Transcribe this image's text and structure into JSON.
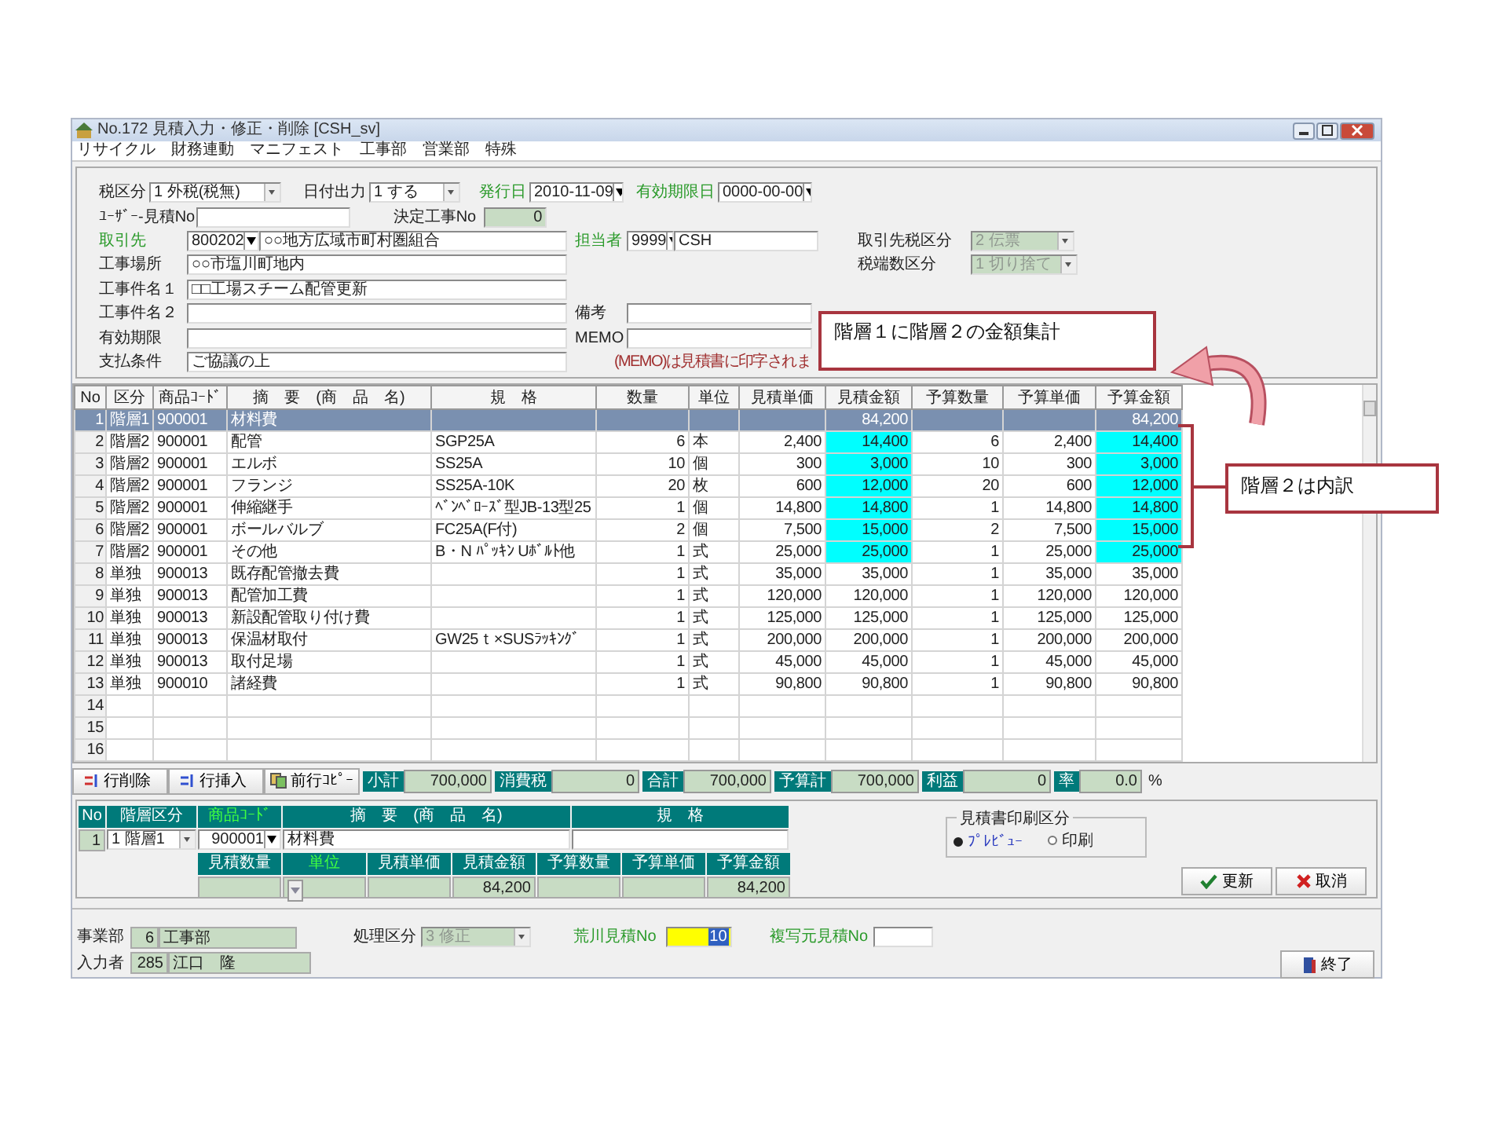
{
  "window": {
    "title": "No.172 見積入力・修正・削除 [CSH_sv]"
  },
  "menu": [
    "リサイクル",
    "財務連動",
    "マニフェスト",
    "工事部",
    "営業部",
    "特殊"
  ],
  "form": {
    "tax_category": {
      "label": "税区分",
      "value": "1 外税(税無)",
      "link": false
    },
    "date_output": {
      "label": "日付出力",
      "value": "1 する",
      "link": false
    },
    "issue_date": {
      "label": "発行日",
      "value": "2010-11-09",
      "link": true
    },
    "expiry_date": {
      "label": "有効期限日",
      "value": "0000-00-00",
      "link": true
    },
    "user_estimate_no": {
      "label": "ﾕｰｻﾞｰ-見積No",
      "link": false
    },
    "decided_job_no": {
      "label": "決定工事No",
      "value": "0",
      "link": false
    },
    "client": {
      "label": "取引先",
      "code": "800202",
      "name": "○○地方広域市町村圏組合",
      "link": true
    },
    "staff": {
      "label": "担当者",
      "code": "9999",
      "name": "CSH",
      "link": true
    },
    "client_tax": {
      "label": "取引先税区分",
      "value": "2 伝票",
      "disabled": true
    },
    "rounding": {
      "label": "税端数区分",
      "value": "1 切り捨て",
      "disabled": true
    },
    "site": {
      "label": "工事場所",
      "value": "○○市塩川町地内"
    },
    "job_name_1": {
      "label": "工事件名１",
      "value": "□□工場スチーム配管更新"
    },
    "job_name_2": {
      "label": "工事件名２"
    },
    "remarks": {
      "label": "備考"
    },
    "validity": {
      "label": "有効期限"
    },
    "memo": {
      "label": "MEMO"
    },
    "payment": {
      "label": "支払条件",
      "value": "ご協議の上"
    },
    "memo_note": "(MEMO)は見積書に印字されま"
  },
  "table": {
    "columns": [
      "No",
      "区分",
      "商品ｺｰﾄﾞ",
      "摘　要　(商　品　名)",
      "規　格",
      "数量",
      "単位",
      "見積単価",
      "見積金額",
      "予算数量",
      "予算単価",
      "予算金額"
    ],
    "rows": [
      {
        "no": "1",
        "category": "階層1",
        "code": "900001",
        "name": "材料費",
        "amount": "84,200",
        "budget_amount": "84,200",
        "selected": true,
        "highlight": false
      },
      {
        "no": "2",
        "category": "階層2",
        "code": "900001",
        "name": "配管",
        "spec": "SGP25A",
        "qty": "6",
        "unit": "本",
        "unit_price": "2,400",
        "amount": "14,400",
        "budget_qty": "6",
        "budget_price": "2,400",
        "budget_amount": "14,400",
        "selected": false,
        "highlight": true
      },
      {
        "no": "3",
        "category": "階層2",
        "code": "900001",
        "name": "エルボ",
        "spec": "SS25A",
        "qty": "10",
        "unit": "個",
        "unit_price": "300",
        "amount": "3,000",
        "budget_qty": "10",
        "budget_price": "300",
        "budget_amount": "3,000",
        "selected": false,
        "highlight": true
      },
      {
        "no": "4",
        "category": "階層2",
        "code": "900001",
        "name": "フランジ",
        "spec": "SS25A-10K",
        "qty": "20",
        "unit": "枚",
        "unit_price": "600",
        "amount": "12,000",
        "budget_qty": "20",
        "budget_price": "600",
        "budget_amount": "12,000",
        "selected": false,
        "highlight": true
      },
      {
        "no": "5",
        "category": "階層2",
        "code": "900001",
        "name": "伸縮継手",
        "spec": "ﾍﾞﾝﾍﾞﾛｰｽﾞ型JB-13型25",
        "qty": "1",
        "unit": "個",
        "unit_price": "14,800",
        "amount": "14,800",
        "budget_qty": "1",
        "budget_price": "14,800",
        "budget_amount": "14,800",
        "selected": false,
        "highlight": true
      },
      {
        "no": "6",
        "category": "階層2",
        "code": "900001",
        "name": "ボールバルブ",
        "spec": "FC25A(F付)",
        "qty": "2",
        "unit": "個",
        "unit_price": "7,500",
        "amount": "15,000",
        "budget_qty": "2",
        "budget_price": "7,500",
        "budget_amount": "15,000",
        "selected": false,
        "highlight": true
      },
      {
        "no": "7",
        "category": "階層2",
        "code": "900001",
        "name": "その他",
        "spec": "B・N ﾊﾟｯｷﾝ Uﾎﾞﾙﾄ他",
        "qty": "1",
        "unit": "式",
        "unit_price": "25,000",
        "amount": "25,000",
        "budget_qty": "1",
        "budget_price": "25,000",
        "budget_amount": "25,000",
        "selected": false,
        "highlight": true
      },
      {
        "no": "8",
        "category": "単独",
        "code": "900013",
        "name": "既存配管撤去費",
        "qty": "1",
        "unit": "式",
        "unit_price": "35,000",
        "amount": "35,000",
        "budget_qty": "1",
        "budget_price": "35,000",
        "budget_amount": "35,000",
        "selected": false,
        "highlight": false
      },
      {
        "no": "9",
        "category": "単独",
        "code": "900013",
        "name": "配管加工費",
        "qty": "1",
        "unit": "式",
        "unit_price": "120,000",
        "amount": "120,000",
        "budget_qty": "1",
        "budget_price": "120,000",
        "budget_amount": "120,000",
        "selected": false,
        "highlight": false
      },
      {
        "no": "10",
        "category": "単独",
        "code": "900013",
        "name": "新設配管取り付け費",
        "qty": "1",
        "unit": "式",
        "unit_price": "125,000",
        "amount": "125,000",
        "budget_qty": "1",
        "budget_price": "125,000",
        "budget_amount": "125,000",
        "selected": false,
        "highlight": false
      },
      {
        "no": "11",
        "category": "単独",
        "code": "900013",
        "name": "保温材取付",
        "spec": "GW25ｔ×SUSﾗｯｷﾝｸﾞ",
        "qty": "1",
        "unit": "式",
        "unit_price": "200,000",
        "amount": "200,000",
        "budget_qty": "1",
        "budget_price": "200,000",
        "budget_amount": "200,000",
        "selected": false,
        "highlight": false
      },
      {
        "no": "12",
        "category": "単独",
        "code": "900013",
        "name": "取付足場",
        "qty": "1",
        "unit": "式",
        "unit_price": "45,000",
        "amount": "45,000",
        "budget_qty": "1",
        "budget_price": "45,000",
        "budget_amount": "45,000",
        "selected": false,
        "highlight": false
      },
      {
        "no": "13",
        "category": "単独",
        "code": "900010",
        "name": "諸経費",
        "qty": "1",
        "unit": "式",
        "unit_price": "90,800",
        "amount": "90,800",
        "budget_qty": "1",
        "budget_price": "90,800",
        "budget_amount": "90,800",
        "selected": false,
        "highlight": false
      },
      {
        "no": "14",
        "selected": false,
        "highlight": false
      },
      {
        "no": "15",
        "selected": false,
        "highlight": false
      },
      {
        "no": "16",
        "selected": false,
        "highlight": false
      }
    ]
  },
  "row_buttons": [
    {
      "label": "行削除",
      "kind": "delete"
    },
    {
      "label": "行挿入",
      "kind": "insert"
    },
    {
      "label": "前行ｺﾋﾟｰ",
      "kind": "copy"
    }
  ],
  "totals": [
    {
      "label": "小計",
      "value": "700,000"
    },
    {
      "label": "消費税",
      "value": "0"
    },
    {
      "label": "合計",
      "value": "700,000"
    },
    {
      "label": "予算計",
      "value": "700,000"
    },
    {
      "label": "利益",
      "value": "0"
    },
    {
      "label": "率",
      "value": "0.0",
      "suffix": "%"
    }
  ],
  "detail": {
    "header": [
      {
        "label": "No",
        "link": false
      },
      {
        "label": "階層区分",
        "link": false
      },
      {
        "label": "商品ｺｰﾄﾞ",
        "link": true
      },
      {
        "label": "摘　要　(商　品　名)",
        "link": false
      },
      {
        "label": "規　格",
        "link": false
      }
    ],
    "no": "1",
    "level": "1 階層1",
    "code": "900001",
    "name": "材料費",
    "columns": [
      {
        "label": "見積数量",
        "link": false
      },
      {
        "label": "単位",
        "link": true,
        "kind": "dropdown"
      },
      {
        "label": "見積単価",
        "link": false
      },
      {
        "label": "見積金額",
        "value": "84,200",
        "link": false
      },
      {
        "label": "予算数量",
        "link": false
      },
      {
        "label": "予算単価",
        "link": false
      },
      {
        "label": "予算金額",
        "value": "84,200",
        "link": false
      }
    ]
  },
  "print_option": {
    "title": "見積書印刷区分",
    "options": [
      {
        "label": "ﾌﾟﾚﾋﾞｭｰ",
        "selected": true
      },
      {
        "label": "印刷",
        "selected": false
      }
    ]
  },
  "actions": [
    {
      "label": "更新",
      "kind": "confirm"
    },
    {
      "label": "取消",
      "kind": "cancel"
    }
  ],
  "footer": {
    "department": {
      "label": "事業部",
      "code": "6",
      "name": "工事部"
    },
    "entered_by": {
      "label": "入力者",
      "code": "285",
      "name": "江口　隆"
    },
    "process": {
      "label": "処理区分",
      "value": "3 修正",
      "disabled": true
    },
    "arakawa_no": {
      "label": "荒川見積No",
      "value": "10",
      "link": true
    },
    "copy_source": {
      "label": "複写元見積No",
      "link": true
    },
    "exit": "終了"
  },
  "annotations": [
    {
      "text": "階層１に階層２の金額集計"
    },
    {
      "text": "階層２は内訳"
    }
  ]
}
